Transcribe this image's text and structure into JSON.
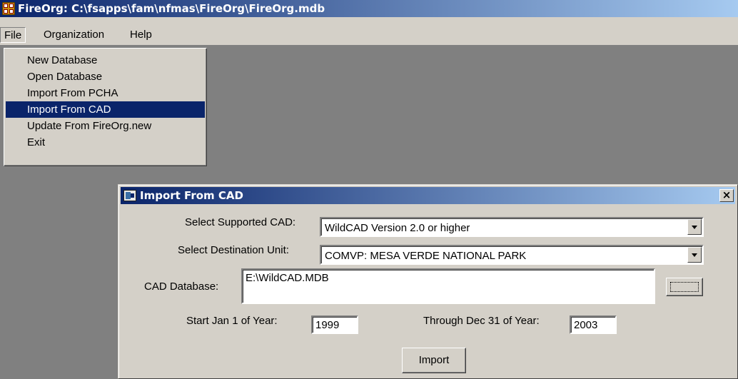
{
  "window": {
    "title": "FireOrg: C:\\fsapps\\fam\\nfmas\\FireOrg\\FireOrg.mdb",
    "icon": "fireorg-app-icon"
  },
  "menubar": {
    "file": "File",
    "organization": "Organization",
    "help": "Help"
  },
  "file_menu": {
    "items": [
      {
        "label": "New Database"
      },
      {
        "label": "Open Database"
      },
      {
        "label": "Import From PCHA"
      },
      {
        "label": "Import From CAD"
      },
      {
        "label": "Update From FireOrg.new"
      },
      {
        "label": "Exit"
      }
    ],
    "selected_index": 3
  },
  "dialog": {
    "title": "Import From CAD",
    "close_label": "×",
    "cad_label": "Select Supported CAD:",
    "cad_value": "WildCAD Version 2.0 or higher",
    "unit_label": "Select Destination Unit:",
    "unit_value": "COMVP: MESA VERDE NATIONAL PARK",
    "db_label": "CAD Database:",
    "db_value": "E:\\WildCAD.MDB",
    "start_label": "Start Jan 1 of Year:",
    "start_value": "1999",
    "through_label": "Through Dec 31 of Year:",
    "through_value": "2003",
    "import_label": "Import"
  },
  "colors": {
    "titlebar_start": "#0a246a",
    "titlebar_end": "#a6caf0",
    "face": "#d4d0c8",
    "desktop": "#808080",
    "selection": "#0a246a"
  }
}
